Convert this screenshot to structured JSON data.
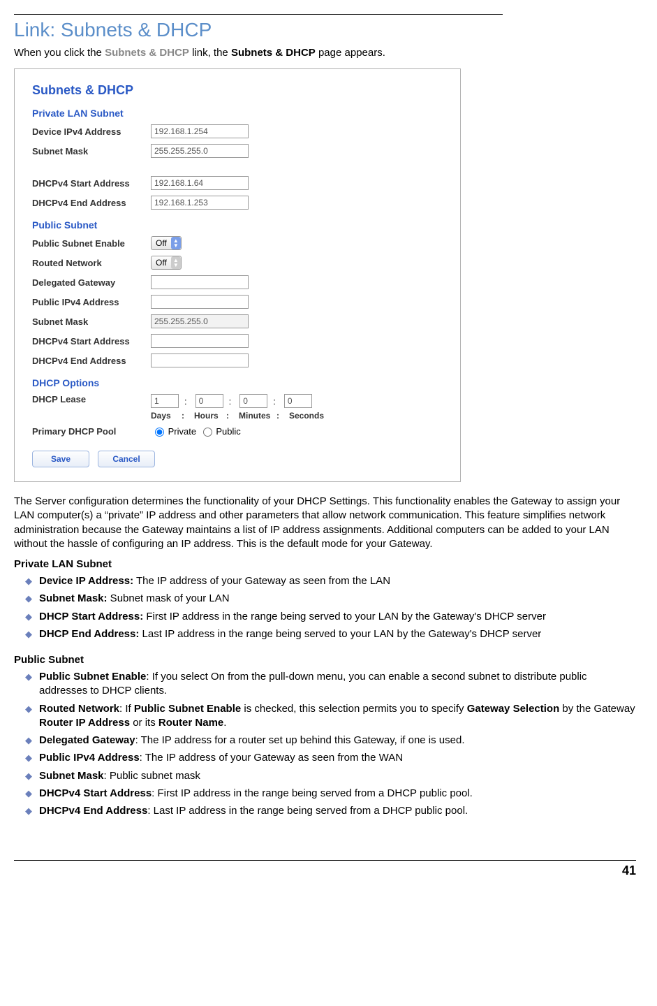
{
  "title": "Link: Subnets & DHCP",
  "intro": {
    "pre": "When you click the ",
    "linkLabel": "Subnets & DHCP",
    "mid": " link, the ",
    "pageLabel": "Subnets & DHCP",
    "post": " page appears."
  },
  "screenshot": {
    "heading": "Subnets & DHCP",
    "sections": {
      "private": {
        "heading": "Private LAN Subnet",
        "rows": {
          "deviceIp": {
            "label": "Device IPv4 Address",
            "value": "192.168.1.254"
          },
          "subnetMask": {
            "label": "Subnet Mask",
            "value": "255.255.255.0"
          },
          "startAddr": {
            "label": "DHCPv4 Start Address",
            "value": "192.168.1.64"
          },
          "endAddr": {
            "label": "DHCPv4 End Address",
            "value": "192.168.1.253"
          }
        }
      },
      "public": {
        "heading": "Public Subnet",
        "rows": {
          "enable": {
            "label": "Public Subnet Enable",
            "value": "Off"
          },
          "routed": {
            "label": "Routed Network",
            "value": "Off"
          },
          "delegated": {
            "label": "Delegated Gateway",
            "value": ""
          },
          "publicIp": {
            "label": "Public IPv4 Address",
            "value": ""
          },
          "subnetMask": {
            "label": "Subnet Mask",
            "value": "255.255.255.0"
          },
          "startAddr": {
            "label": "DHCPv4 Start Address",
            "value": ""
          },
          "endAddr": {
            "label": "DHCPv4 End Address",
            "value": ""
          }
        }
      },
      "dhcpOptions": {
        "heading": "DHCP Options",
        "lease": {
          "label": "DHCP Lease",
          "days": {
            "value": "1",
            "unit": "Days"
          },
          "hours": {
            "value": "0",
            "unit": "Hours"
          },
          "minutes": {
            "value": "0",
            "unit": "Minutes"
          },
          "seconds": {
            "value": "0",
            "unit": "Seconds"
          },
          "colon": ":"
        },
        "pool": {
          "label": "Primary DHCP Pool",
          "private": "Private",
          "public": "Public"
        }
      }
    },
    "buttons": {
      "save": "Save",
      "cancel": "Cancel"
    }
  },
  "body": {
    "para1": "The Server configuration determines the functionality of your DHCP Settings. This functionality enables the Gateway to assign your LAN computer(s) a “private” IP address and other parameters that allow network communication. This feature simplifies network administration because the Gateway maintains a list of IP address assignments. Additional computers can be added to your LAN without the hassle of configuring an IP address. This is the default mode for your Gateway.",
    "privateHeading": "Private LAN Subnet",
    "privateItems": [
      {
        "bold": "Device IP Address:",
        "text": " The IP address of your Gateway as seen from the LAN"
      },
      {
        "bold": "Subnet Mask:",
        "text": " Subnet mask of your LAN"
      },
      {
        "bold": "DHCP Start Address:",
        "text": " First IP address in the range being served to your LAN by the Gateway's DHCP server"
      },
      {
        "bold": "DHCP End Address:",
        "text": " Last IP address in the range being served to your LAN by the Gateway's DHCP server"
      }
    ],
    "publicHeading": "Public Subnet",
    "publicItems": [
      {
        "segments": [
          {
            "bold": "Public Subnet Enable"
          },
          {
            "text": ": If you select On from the pull-down menu, you can enable a second subnet to distribute public addresses to DHCP clients."
          }
        ]
      },
      {
        "segments": [
          {
            "bold": "Routed Network"
          },
          {
            "text": ": If "
          },
          {
            "bold": "Public Subnet Enable"
          },
          {
            "text": " is checked, this selection permits you to specify "
          },
          {
            "bold": "Gateway Selection"
          },
          {
            "text": " by the Gateway "
          },
          {
            "bold": "Router IP Address"
          },
          {
            "text": " or its "
          },
          {
            "bold": "Router Name"
          },
          {
            "text": "."
          }
        ]
      },
      {
        "segments": [
          {
            "bold": "Delegated Gateway"
          },
          {
            "text": ": The IP address for a router set up behind this Gateway, if one is used."
          }
        ]
      },
      {
        "segments": [
          {
            "bold": "Public IPv4 Address"
          },
          {
            "text": ": The IP address of your Gateway as seen from the WAN"
          }
        ]
      },
      {
        "segments": [
          {
            "bold": "Subnet Mask"
          },
          {
            "text": ": Public subnet mask"
          }
        ]
      },
      {
        "segments": [
          {
            "bold": "DHCPv4 Start Address"
          },
          {
            "text": ": First IP address in the range being served from a DHCP public pool."
          }
        ]
      },
      {
        "segments": [
          {
            "bold": "DHCPv4 End Address"
          },
          {
            "text": ": Last IP address in the range being served from a DHCP public pool."
          }
        ]
      }
    ]
  },
  "pageNumber": "41"
}
